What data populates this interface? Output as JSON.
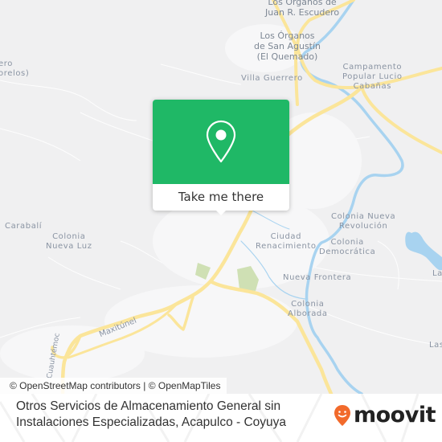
{
  "map": {
    "labels": {
      "juan_escudero": "Los Órganos de\nJuan R. Escudero",
      "san_agustin": "Los Órganos\nde San Agustín\n(El Quemado)",
      "villa_guerrero": "Villa Guerrero",
      "campamento": "Campamento\nPopular Lucio\nCabañas",
      "left_edge_top": "ero\norelos)",
      "carabali": "Carabalí",
      "nueva_luz": "Colonia\nNueva Luz",
      "ciudad_renacimiento": "Ciudad\nRenacimiento",
      "nueva_revolucion": "Colonia Nueva\nRevolución",
      "democratica": "Colonia\nDemocrática",
      "nueva_frontera": "Nueva Frontera",
      "alborada": "Colonia\nAlborada",
      "right_la": "La",
      "right_las": "Las",
      "maxitunel": "Maxitúnel",
      "cuauhtemoc": "Cuauhtémoc"
    },
    "colors": {
      "background": "#f0f0f1",
      "road": "#fbe59a",
      "water": "#a8d3f0",
      "park": "#cfe0b4"
    }
  },
  "popup": {
    "icon": "map-pin-icon",
    "button_label": "Take me there",
    "accent_color": "#1fb866"
  },
  "attribution": "© OpenStreetMap contributors | © OpenMapTiles",
  "footer": {
    "title": "Otros Servicios de Almacenamiento General sin Instalaciones Especializadas, Acapulco - Coyuya",
    "brand": "moovit",
    "brand_color": "#f26a2b"
  }
}
